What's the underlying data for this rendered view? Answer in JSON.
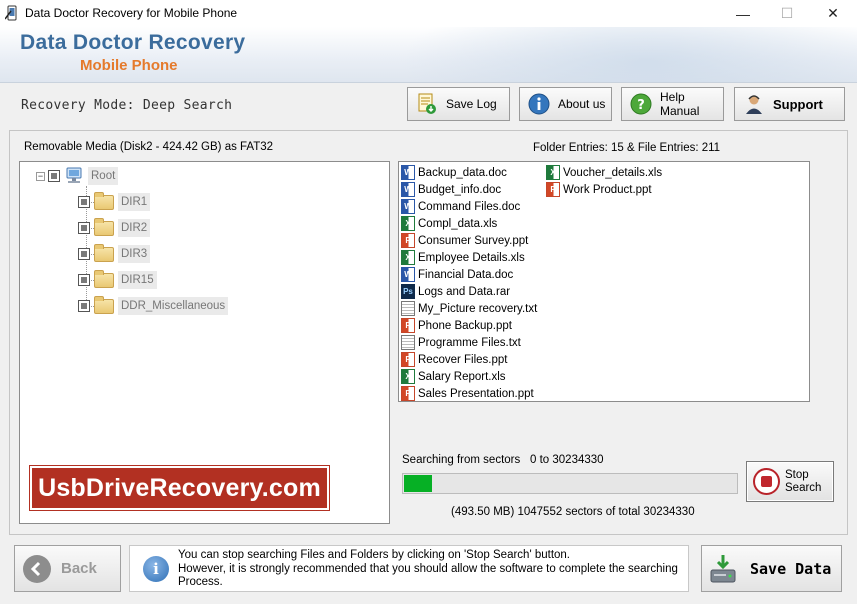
{
  "window": {
    "title": "Data Doctor Recovery for Mobile Phone",
    "minimize": "—",
    "maximize": "☐",
    "close": "✕"
  },
  "banner": {
    "title": "Data Doctor Recovery",
    "subtitle": "Mobile Phone"
  },
  "toolbar": {
    "mode": "Recovery Mode: Deep Search",
    "save_log": "Save Log",
    "about_us": "About us",
    "help_manual": "Help Manual",
    "support": "Support"
  },
  "media": {
    "label": "Removable Media (Disk2 - 424.42 GB) as FAT32",
    "entries": "Folder Entries: 15 & File Entries: 211"
  },
  "tree": {
    "root": "Root",
    "folders": [
      "DIR1",
      "DIR2",
      "DIR3",
      "DIR15",
      "DDR_Miscellaneous"
    ]
  },
  "files": [
    {
      "name": "Backup_data.doc",
      "type": "doc"
    },
    {
      "name": "Budget_info.doc",
      "type": "doc"
    },
    {
      "name": "Command Files.doc",
      "type": "doc"
    },
    {
      "name": "Compl_data.xls",
      "type": "xls"
    },
    {
      "name": "Consumer Survey.ppt",
      "type": "ppt"
    },
    {
      "name": "Employee Details.xls",
      "type": "xls"
    },
    {
      "name": "Financial Data.doc",
      "type": "doc"
    },
    {
      "name": "Logs and Data.rar",
      "type": "rar"
    },
    {
      "name": "My_Picture recovery.txt",
      "type": "txt"
    },
    {
      "name": "Phone Backup.ppt",
      "type": "ppt"
    },
    {
      "name": "Programme Files.txt",
      "type": "txt"
    },
    {
      "name": "Recover Files.ppt",
      "type": "ppt"
    },
    {
      "name": "Salary Report.xls",
      "type": "xls"
    },
    {
      "name": "Sales Presentation.ppt",
      "type": "ppt"
    },
    {
      "name": "Voucher_details.xls",
      "type": "xls"
    },
    {
      "name": "Work Product.ppt",
      "type": "ppt"
    }
  ],
  "watermark": "UsbDriveRecovery.com",
  "search": {
    "label": "Searching from sectors",
    "range": "0  to 30234330",
    "progress_fraction": 0.035,
    "sector_text": "(493.50 MB) 1047552   sectors  of  total 30234330",
    "stop_line1": "Stop",
    "stop_line2": "Search"
  },
  "footer": {
    "back": "Back",
    "info_line1": "You can stop searching Files and Folders by clicking on 'Stop Search' button.",
    "info_line2": "However, it is strongly recommended that you should allow the software to complete the searching Process.",
    "save_data": "Save Data"
  },
  "colors": {
    "banner_title": "#3b6c9c",
    "banner_sub": "#e57a2b",
    "progress": "#06b025",
    "watermark_bg": "#b23022",
    "stop_red": "#c0272d"
  }
}
